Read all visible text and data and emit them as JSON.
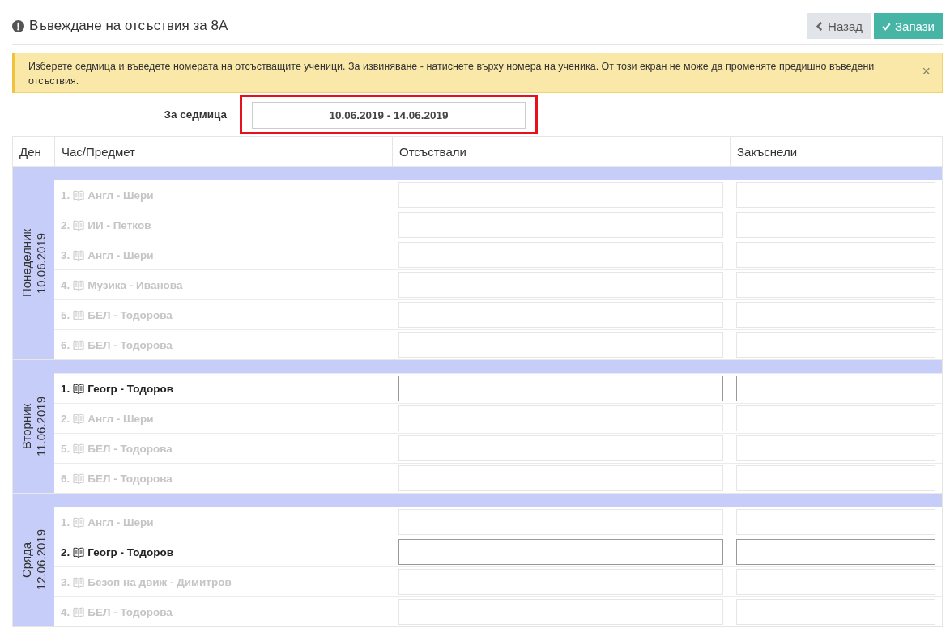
{
  "page": {
    "title": "Въвеждане на отсъствия за 8А"
  },
  "buttons": [
    {
      "label": "Назад",
      "kind": "back"
    },
    {
      "label": "Запази",
      "kind": "save"
    }
  ],
  "alert": {
    "text": "Изберете седмица и въведете номерата на отсъстващите ученици. За извиняване - натиснете върху номера на ученика. От този екран не може да променяте предишно въведени отсъствия.",
    "close": "×"
  },
  "week": {
    "label": "За седмица",
    "value": "10.06.2019 - 14.06.2019",
    "highlighted": true
  },
  "table": {
    "columns": [
      "Ден",
      "Час/Предмет",
      "Отсъствали",
      "Закъснели"
    ],
    "days": [
      {
        "day": "Понеделник",
        "date": "10.06.2019",
        "lessons": [
          {
            "number": "1.",
            "subject": "Англ - Шери",
            "disabled": true
          },
          {
            "number": "2.",
            "subject": "ИИ - Петков",
            "disabled": true
          },
          {
            "number": "3.",
            "subject": "Англ - Шери",
            "disabled": true
          },
          {
            "number": "4.",
            "subject": "Музика - Иванова",
            "disabled": true
          },
          {
            "number": "5.",
            "subject": "БЕЛ - Тодорова",
            "disabled": true
          },
          {
            "number": "6.",
            "subject": "БЕЛ - Тодорова",
            "disabled": true
          }
        ]
      },
      {
        "day": "Вторник",
        "date": "11.06.2019",
        "lessons": [
          {
            "number": "1.",
            "subject": "Геогр - Тодоров",
            "disabled": false
          },
          {
            "number": "2.",
            "subject": "Англ - Шери",
            "disabled": true
          },
          {
            "number": "5.",
            "subject": "БЕЛ - Тодорова",
            "disabled": true
          },
          {
            "number": "6.",
            "subject": "БЕЛ - Тодорова",
            "disabled": true
          }
        ]
      },
      {
        "day": "Сряда",
        "date": "12.06.2019",
        "lessons": [
          {
            "number": "1.",
            "subject": "Англ - Шери",
            "disabled": true
          },
          {
            "number": "2.",
            "subject": "Геогр - Тодоров",
            "disabled": false
          },
          {
            "number": "3.",
            "subject": "Безоп на движ - Димитров",
            "disabled": true
          },
          {
            "number": "4.",
            "subject": "БЕЛ - Тодорова",
            "disabled": true
          }
        ]
      }
    ]
  }
}
